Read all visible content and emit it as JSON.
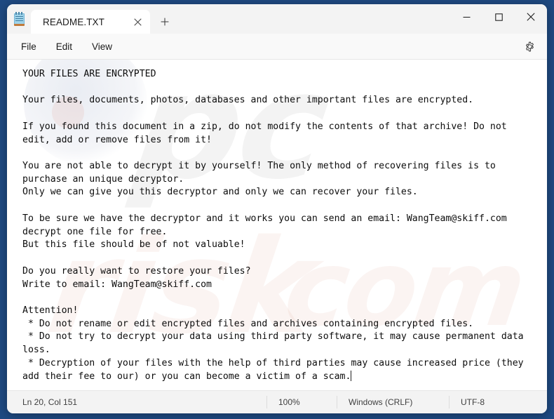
{
  "window": {
    "app_icon": "notepad-icon",
    "caption": {
      "minimize": "minimize-icon",
      "maximize": "maximize-icon",
      "close": "close-icon"
    }
  },
  "tabs": [
    {
      "label": "README.TXT",
      "close_icon": "close-icon",
      "active": true
    }
  ],
  "new_tab": {
    "icon": "plus-icon",
    "label": "+"
  },
  "menu": {
    "items": [
      {
        "label": "File"
      },
      {
        "label": "Edit"
      },
      {
        "label": "View"
      }
    ],
    "settings_icon": "gear-icon"
  },
  "watermark": {
    "part1": "pc",
    "part2": "risk",
    "part3": "com"
  },
  "document": {
    "content": "YOUR FILES ARE ENCRYPTED\n\nYour files, documents, photos, databases and other important files are encrypted.\n\nIf you found this document in a zip, do not modify the contents of that archive! Do not edit, add or remove files from it!\n\nYou are not able to decrypt it by yourself! The only method of recovering files is to purchase an unique decryptor.\nOnly we can give you this decryptor and only we can recover your files.\n\nTo be sure we have the decryptor and it works you can send an email: WangTeam@skiff.com decrypt one file for free.\nBut this file should be of not valuable!\n\nDo you really want to restore your files?\nWrite to email: WangTeam@skiff.com\n\nAttention!\n * Do not rename or edit encrypted files and archives containing encrypted files.\n * Do not try to decrypt your data using third party software, it may cause permanent data loss.\n * Decryption of your files with the help of third parties may cause increased price (they add their fee to our) or you can become a victim of a scam."
  },
  "status": {
    "position": "Ln 20, Col 151",
    "zoom": "100%",
    "line_ending": "Windows (CRLF)",
    "encoding": "UTF-8"
  },
  "colors": {
    "desktop": "#1f4a82",
    "window_chrome": "#f3f3f3",
    "editor_bg": "#ffffff",
    "text": "#0d0d0d",
    "accent": "#c42b1c"
  }
}
